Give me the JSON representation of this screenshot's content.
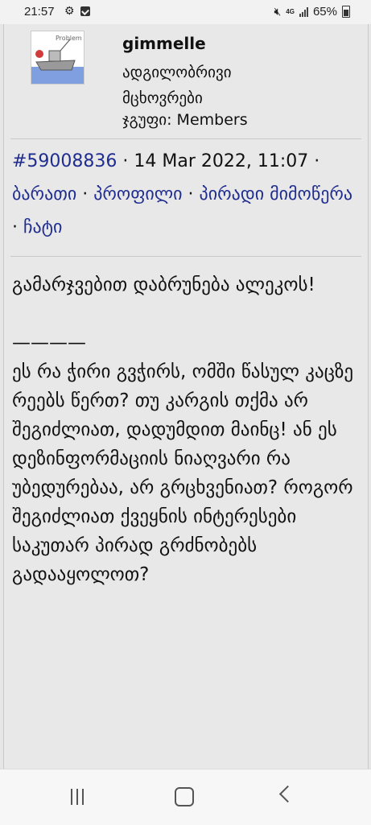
{
  "status_bar": {
    "time": "21:57",
    "network_label": "4G",
    "battery": "65%",
    "icons": [
      "gear-icon",
      "notification-check-icon",
      "mute-icon",
      "signal-icon",
      "battery-icon"
    ]
  },
  "user": {
    "name": "gimmelle",
    "title_line1": "ადგილობრივი",
    "title_line2": "მცხოვრები",
    "group": "ჯგუფი: Members",
    "avatar_text": "Problem"
  },
  "post_meta": {
    "post_id": "#59008836",
    "sep1": " · ",
    "date": "14 Mar 2022, 11:07",
    "sep2": " · ",
    "link_1": "ბარათი",
    "sep3": " · ",
    "link_2": "პროფილი",
    "sep4": " · ",
    "link_3": "პირადი მიმოწერა",
    "sep5": " · ",
    "link_4": "ჩატი"
  },
  "post_body": {
    "greeting": "გამარჯვებით დაბრუნება ალეკოს!",
    "divider": "————",
    "paragraph": "ეს რა ჭირი გვჭირს, ომში წასულ კაცზე რეებს წერთ? თუ კარგის თქმა არ შეგიძლიათ, დადუმდით მაინც! ან ეს დეზინფორმაციის ნიაღვარი რა უბედურებაა, არ გრცხვენიათ? როგორ შეგიძლიათ ქვეყნის ინტერესები საკუთარ პირად გრძნობებს გადააყოლოთ?"
  },
  "colors": {
    "link": "#1f2d8f",
    "background": "#e8e8e8",
    "separator": "#c8c8c8"
  }
}
